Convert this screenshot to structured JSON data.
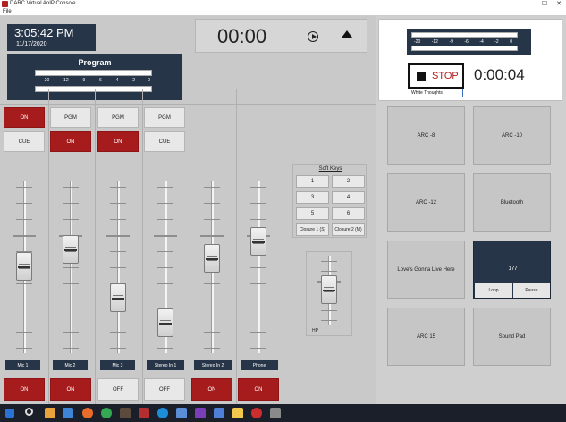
{
  "window": {
    "title": "DARC Virtual AoIP Console",
    "minimize": "—",
    "maximize": "☐",
    "close": "✕"
  },
  "menu": {
    "file": "File"
  },
  "clock": {
    "time": "3:05:42 PM",
    "date": "11/17/2020"
  },
  "program_meter": {
    "title": "Program",
    "scale": [
      "-20",
      "-12",
      "-9",
      "-6",
      "-4",
      "-2",
      "0"
    ]
  },
  "transport": {
    "timer": "00:00"
  },
  "cart_meter": {
    "scale": [
      "-20",
      "-12",
      "-9",
      "-6",
      "-4",
      "-2",
      "0"
    ]
  },
  "cart": {
    "stop_label": "STOP",
    "elapsed": "0:00:04",
    "name_value": "White Thoughts"
  },
  "strips": [
    {
      "top": "ON",
      "second": "CUE",
      "label": "Mic 1",
      "bottom": "ON",
      "fader_level": 0.5
    },
    {
      "top": "PGM",
      "second": "ON",
      "label": "Mic 2",
      "bottom": "ON",
      "fader_level": 0.62
    },
    {
      "top": "PGM",
      "second": "ON",
      "label": "Mic 3",
      "bottom": "OFF",
      "fader_level": 0.28
    },
    {
      "top": "PGM",
      "second": "CUE",
      "label": "Stereo In 1",
      "bottom": "OFF",
      "fader_level": 0.1
    },
    {
      "label": "Stereo In 2",
      "bottom": "ON",
      "fader_level": 0.56
    },
    {
      "label": "Phone",
      "bottom": "ON",
      "fader_level": 0.68
    }
  ],
  "soft_keys": {
    "title": "Soft Keys",
    "keys": [
      "1",
      "2",
      "3",
      "4",
      "5",
      "6",
      "Closure 1 (S)",
      "Closure 2 (M)"
    ]
  },
  "headphone": {
    "label": "HP",
    "fader_level": 0.5
  },
  "pads": [
    {
      "label": "ARC -8"
    },
    {
      "label": "ARC -10"
    },
    {
      "label": "ARC -12"
    },
    {
      "label": "Bluetooth"
    },
    {
      "label": "Love's Gonna Live Here"
    },
    {
      "label": "177",
      "loop": "Loop",
      "pause": "Pause"
    },
    {
      "label": "ARC 15"
    },
    {
      "label": "Sound Pad"
    }
  ],
  "colors": {
    "navy": "#273548",
    "red": "#a61c1c",
    "panel": "#c9c9c9"
  }
}
